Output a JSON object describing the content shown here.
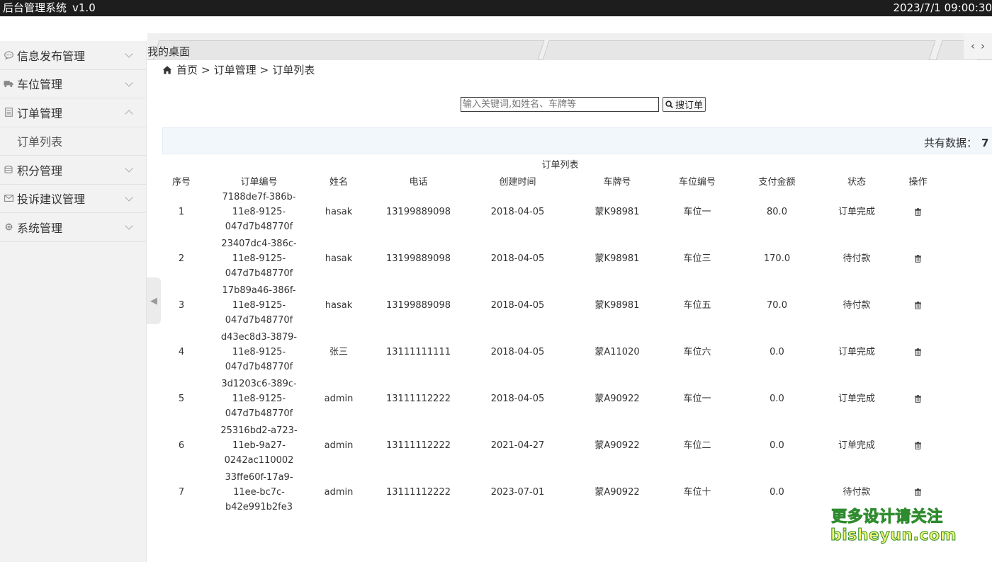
{
  "header": {
    "app_title": "后台管理系统",
    "version": "v1.0",
    "datetime": "2023/7/1 09:00:30"
  },
  "sidebar": {
    "items": [
      {
        "label": "信息发布管理",
        "icon": "comment-icon",
        "expanded": false
      },
      {
        "label": "车位管理",
        "icon": "truck-icon",
        "expanded": false
      },
      {
        "label": "订单管理",
        "icon": "document-icon",
        "expanded": true,
        "children": [
          {
            "label": "订单列表"
          }
        ]
      },
      {
        "label": "积分管理",
        "icon": "database-icon",
        "expanded": false
      },
      {
        "label": "投诉建议管理",
        "icon": "envelope-icon",
        "expanded": false
      },
      {
        "label": "系统管理",
        "icon": "gear-icon",
        "expanded": false
      }
    ]
  },
  "tabs": {
    "active_label": "我的桌面",
    "prev_icon": "‹",
    "next_icon": "›"
  },
  "breadcrumb": {
    "icon": "home-icon",
    "items": [
      "首页",
      "订单管理",
      "订单列表"
    ],
    "separator": ">"
  },
  "search": {
    "placeholder": "输入关键词,如姓名、车牌等",
    "value": "",
    "button_label": "搜订单",
    "button_icon": "search-icon"
  },
  "summary": {
    "label": "共有数据：",
    "count": "7 条"
  },
  "table": {
    "caption": "订单列表",
    "headers": [
      "序号",
      "订单编号",
      "姓名",
      "电话",
      "创建时间",
      "车牌号",
      "车位编号",
      "支付金额",
      "状态",
      "操作"
    ],
    "rows": [
      {
        "index": "1",
        "order_no": [
          "7188de7f-386b-",
          "11e8-9125-",
          "047d7b48770f"
        ],
        "name": "hasak",
        "phone": "13199889098",
        "created": "2018-04-05",
        "plate": "蒙K98981",
        "spot": "车位一",
        "amount": "80.0",
        "status": "订单完成"
      },
      {
        "index": "2",
        "order_no": [
          "23407dc4-386c-",
          "11e8-9125-",
          "047d7b48770f"
        ],
        "name": "hasak",
        "phone": "13199889098",
        "created": "2018-04-05",
        "plate": "蒙K98981",
        "spot": "车位三",
        "amount": "170.0",
        "status": "待付款"
      },
      {
        "index": "3",
        "order_no": [
          "17b89a46-386f-",
          "11e8-9125-",
          "047d7b48770f"
        ],
        "name": "hasak",
        "phone": "13199889098",
        "created": "2018-04-05",
        "plate": "蒙K98981",
        "spot": "车位五",
        "amount": "70.0",
        "status": "待付款"
      },
      {
        "index": "4",
        "order_no": [
          "d43ec8d3-3879-",
          "11e8-9125-",
          "047d7b48770f"
        ],
        "name": "张三",
        "phone": "13111111111",
        "created": "2018-04-05",
        "plate": "蒙A11020",
        "spot": "车位六",
        "amount": "0.0",
        "status": "订单完成"
      },
      {
        "index": "5",
        "order_no": [
          "3d1203c6-389c-",
          "11e8-9125-",
          "047d7b48770f"
        ],
        "name": "admin",
        "phone": "13111112222",
        "created": "2018-04-05",
        "plate": "蒙A90922",
        "spot": "车位一",
        "amount": "0.0",
        "status": "订单完成"
      },
      {
        "index": "6",
        "order_no": [
          "25316bd2-a723-",
          "11eb-9a27-",
          "0242ac110002"
        ],
        "name": "admin",
        "phone": "13111112222",
        "created": "2021-04-27",
        "plate": "蒙A90922",
        "spot": "车位二",
        "amount": "0.0",
        "status": "订单完成"
      },
      {
        "index": "7",
        "order_no": [
          "33ffe60f-17a9-",
          "11ee-bc7c-",
          "b42e991b2fe3"
        ],
        "name": "admin",
        "phone": "13111112222",
        "created": "2023-07-01",
        "plate": "蒙A90922",
        "spot": "车位十",
        "amount": "0.0",
        "status": "待付款"
      }
    ],
    "row_action_icon": "trash-icon"
  },
  "watermark": {
    "line1": "更多设计请关注",
    "line2": "bisheyun.com"
  },
  "colors": {
    "topbar_bg": "#1d1d1d",
    "sidebar_bg": "#f2f2f2",
    "infobar_bg": "#f2f7fc",
    "watermark_fill": "#f3f870",
    "watermark_stroke": "#2e8b2e"
  }
}
